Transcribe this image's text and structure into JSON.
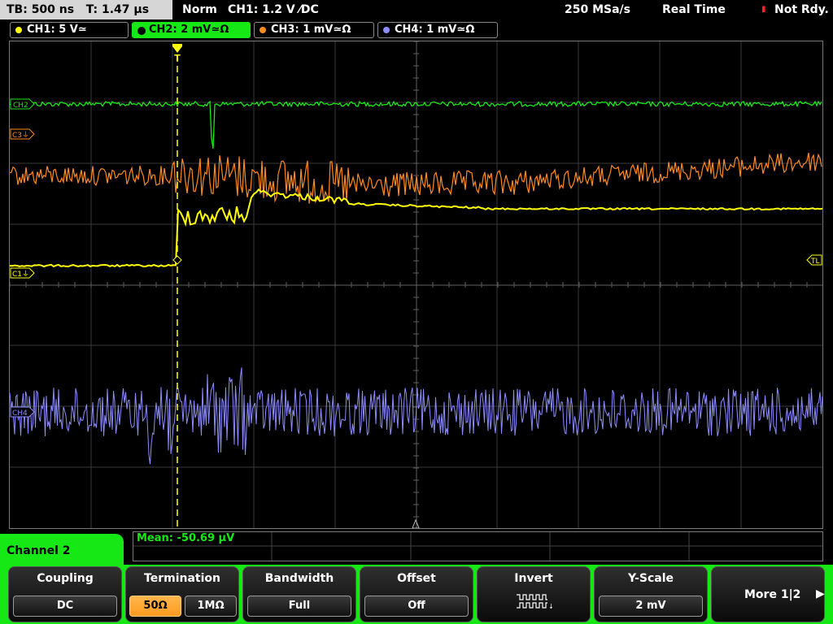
{
  "status": {
    "timebase": "TB: 500 ns",
    "trigger_time": "T: 1.47 µs",
    "mode": "Norm",
    "trigger": "CH1: 1.2 V ⁄DC",
    "sample_rate": "250 MSa/s",
    "acq_mode": "Real Time",
    "state": "Not Rdy."
  },
  "channels": [
    {
      "label": "CH1: 5 V≃",
      "color": "#ffff00",
      "active": false
    },
    {
      "label": "CH2: 2 mV≃Ω",
      "color": "#15e815",
      "active": true
    },
    {
      "label": "CH3: 1 mV≃Ω",
      "color": "#ff8a1e",
      "active": false
    },
    {
      "label": "CH4: 1 mV≃Ω",
      "color": "#8d8dff",
      "active": false
    }
  ],
  "markers": {
    "ch2": "CH2",
    "ch3": "C3⏚",
    "ch1": "C1⏚",
    "ch4": "CH4",
    "trigger_level": "TL",
    "trigger_pos": "T"
  },
  "measurement": {
    "mean": "Mean: -50.69 µV"
  },
  "menu": {
    "channel_title": "Channel 2",
    "coupling": {
      "title": "Coupling",
      "value": "DC"
    },
    "termination": {
      "title": "Termination",
      "options": [
        "50Ω",
        "1MΩ"
      ],
      "selected": 0
    },
    "bandwidth": {
      "title": "Bandwidth",
      "value": "Full"
    },
    "offset": {
      "title": "Offset",
      "value": "Off"
    },
    "invert": {
      "title": "Invert",
      "icon": "invert-waveform-icon"
    },
    "y_scale": {
      "title": "Y-Scale",
      "value": "2 mV"
    },
    "more": {
      "label": "More 1|2",
      "icon": "right-arrow-icon"
    }
  }
}
